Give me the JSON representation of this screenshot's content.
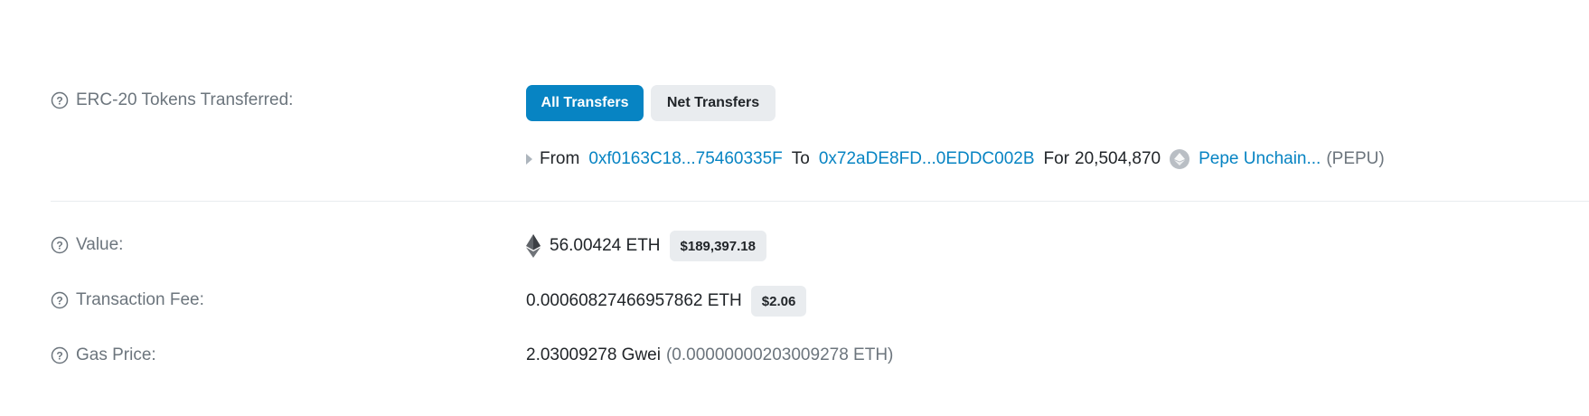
{
  "erc20": {
    "label": "ERC-20 Tokens Transferred:",
    "tabs": [
      {
        "label": "All Transfers",
        "active": true
      },
      {
        "label": "Net Transfers",
        "active": false
      }
    ],
    "transfer": {
      "from_label": "From",
      "from_address": "0xf0163C18...75460335F",
      "to_label": "To",
      "to_address": "0x72aDE8FD...0EDDC002B",
      "for_label": "For",
      "amount": "20,504,870",
      "token_name": "Pepe Unchain...",
      "token_symbol": "(PEPU)",
      "token_icon": "token-icon"
    }
  },
  "value": {
    "label": "Value:",
    "amount": "56.00424 ETH",
    "usd": "$189,397.18",
    "icon": "ethereum-icon"
  },
  "fee": {
    "label": "Transaction Fee:",
    "amount": "0.00060827466957862 ETH",
    "usd": "$2.06"
  },
  "gas": {
    "label": "Gas Price:",
    "gwei": "2.03009278 Gwei",
    "eth": "(0.00000000203009278 ETH)"
  },
  "colors": {
    "accent": "#0784c3",
    "muted": "#6c757d",
    "badge_bg": "#e9ecef"
  }
}
